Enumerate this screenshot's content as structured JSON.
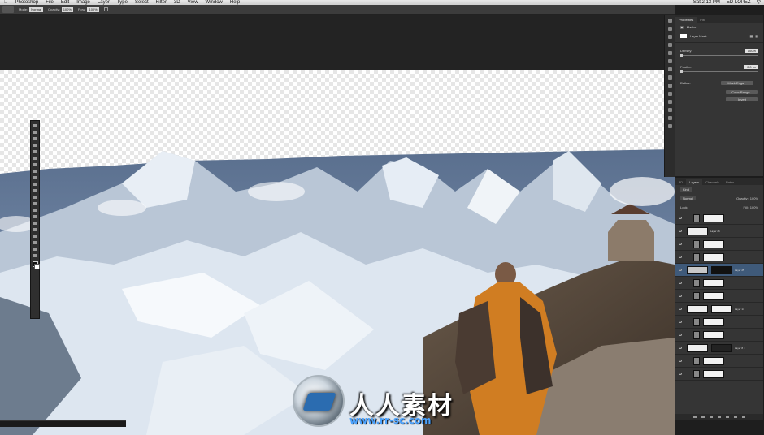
{
  "menubar": {
    "app": "Photoshop",
    "items": [
      "File",
      "Edit",
      "Image",
      "Layer",
      "Type",
      "Select",
      "Filter",
      "3D",
      "View",
      "Window",
      "Help"
    ],
    "clock": "Sat 2:13 PM",
    "user": "ED LOPEZ"
  },
  "options": {
    "mode_label": "Mode:",
    "mode_value": "Normal",
    "opacity_label": "Opacity:",
    "opacity_value": "100%",
    "flow_label": "Flow:",
    "flow_value": "100%"
  },
  "properties": {
    "tabs": [
      "Properties",
      "Info"
    ],
    "title": "Masks",
    "layer_mask_label": "Layer Mask",
    "density_label": "Density:",
    "density_value": "100%",
    "feather_label": "Feather:",
    "feather_value": "0.0 px",
    "refine_label": "Refine:",
    "buttons": [
      "Mask Edge...",
      "Color Range...",
      "Invert"
    ]
  },
  "layers": {
    "tabs": [
      "3D",
      "Layers",
      "Channels",
      "Paths"
    ],
    "kind_label": "Kind",
    "blend_mode": "Normal",
    "opacity_label": "Opacity:",
    "opacity_value": "100%",
    "lock_label": "Lock:",
    "fill_label": "Fill:",
    "fill_value": "100%",
    "rows": [
      {
        "name": "",
        "selected": false
      },
      {
        "name": "Layer 26",
        "selected": false
      },
      {
        "name": "",
        "selected": false
      },
      {
        "name": "",
        "selected": false
      },
      {
        "name": "Layer 25",
        "selected": true
      },
      {
        "name": "",
        "selected": false
      },
      {
        "name": "",
        "selected": false
      },
      {
        "name": "Layer 14",
        "selected": false
      },
      {
        "name": "",
        "selected": false
      },
      {
        "name": "",
        "selected": false
      },
      {
        "name": "Layer 8 c",
        "selected": false
      },
      {
        "name": "",
        "selected": false
      },
      {
        "name": "",
        "selected": false
      }
    ]
  },
  "watermark": {
    "text": "人人素材",
    "url": "www.rr-sc.com"
  }
}
